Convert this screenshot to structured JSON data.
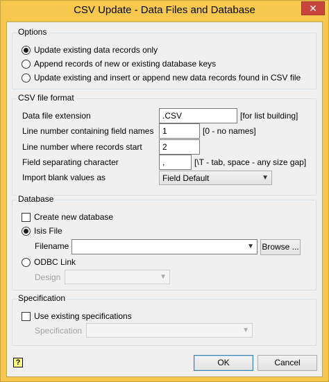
{
  "window": {
    "title": "CSV Update - Data Files and Database",
    "close_glyph": "✕"
  },
  "options": {
    "legend": "Options",
    "items": [
      {
        "label": "Update existing data records only",
        "selected": true
      },
      {
        "label": "Append records of new or existing database keys",
        "selected": false
      },
      {
        "label": "Update existing and insert or append new data records found in CSV file",
        "selected": false
      }
    ]
  },
  "csv_format": {
    "legend": "CSV file format",
    "extension_label": "Data file extension",
    "extension_value": ".CSV",
    "extension_hint": "[for list building]",
    "names_line_label": "Line number containing field names",
    "names_line_value": "1",
    "names_line_hint": "[0 - no names]",
    "records_start_label": "Line number where records start",
    "records_start_value": "2",
    "separator_label": "Field separating character",
    "separator_value": ",",
    "separator_hint": "[\\T - tab, space - any size gap]",
    "blank_label": "Import blank values as",
    "blank_value": "Field Default"
  },
  "database": {
    "legend": "Database",
    "create_new_label": "Create new database",
    "create_new_checked": false,
    "isis_label": "Isis File",
    "isis_selected": true,
    "filename_label": "Filename",
    "filename_value": "",
    "browse_label": "Browse ...",
    "odbc_label": "ODBC Link",
    "odbc_selected": false,
    "design_label": "Design",
    "design_value": ""
  },
  "specification": {
    "legend": "Specification",
    "use_existing_label": "Use existing specifications",
    "use_existing_checked": false,
    "spec_label": "Specification",
    "spec_value": ""
  },
  "footer": {
    "help_glyph": "?",
    "ok_label": "OK",
    "cancel_label": "Cancel"
  },
  "icons": {
    "close": "close-icon",
    "dropdown": "chevron-down-icon",
    "help": "help-icon"
  }
}
